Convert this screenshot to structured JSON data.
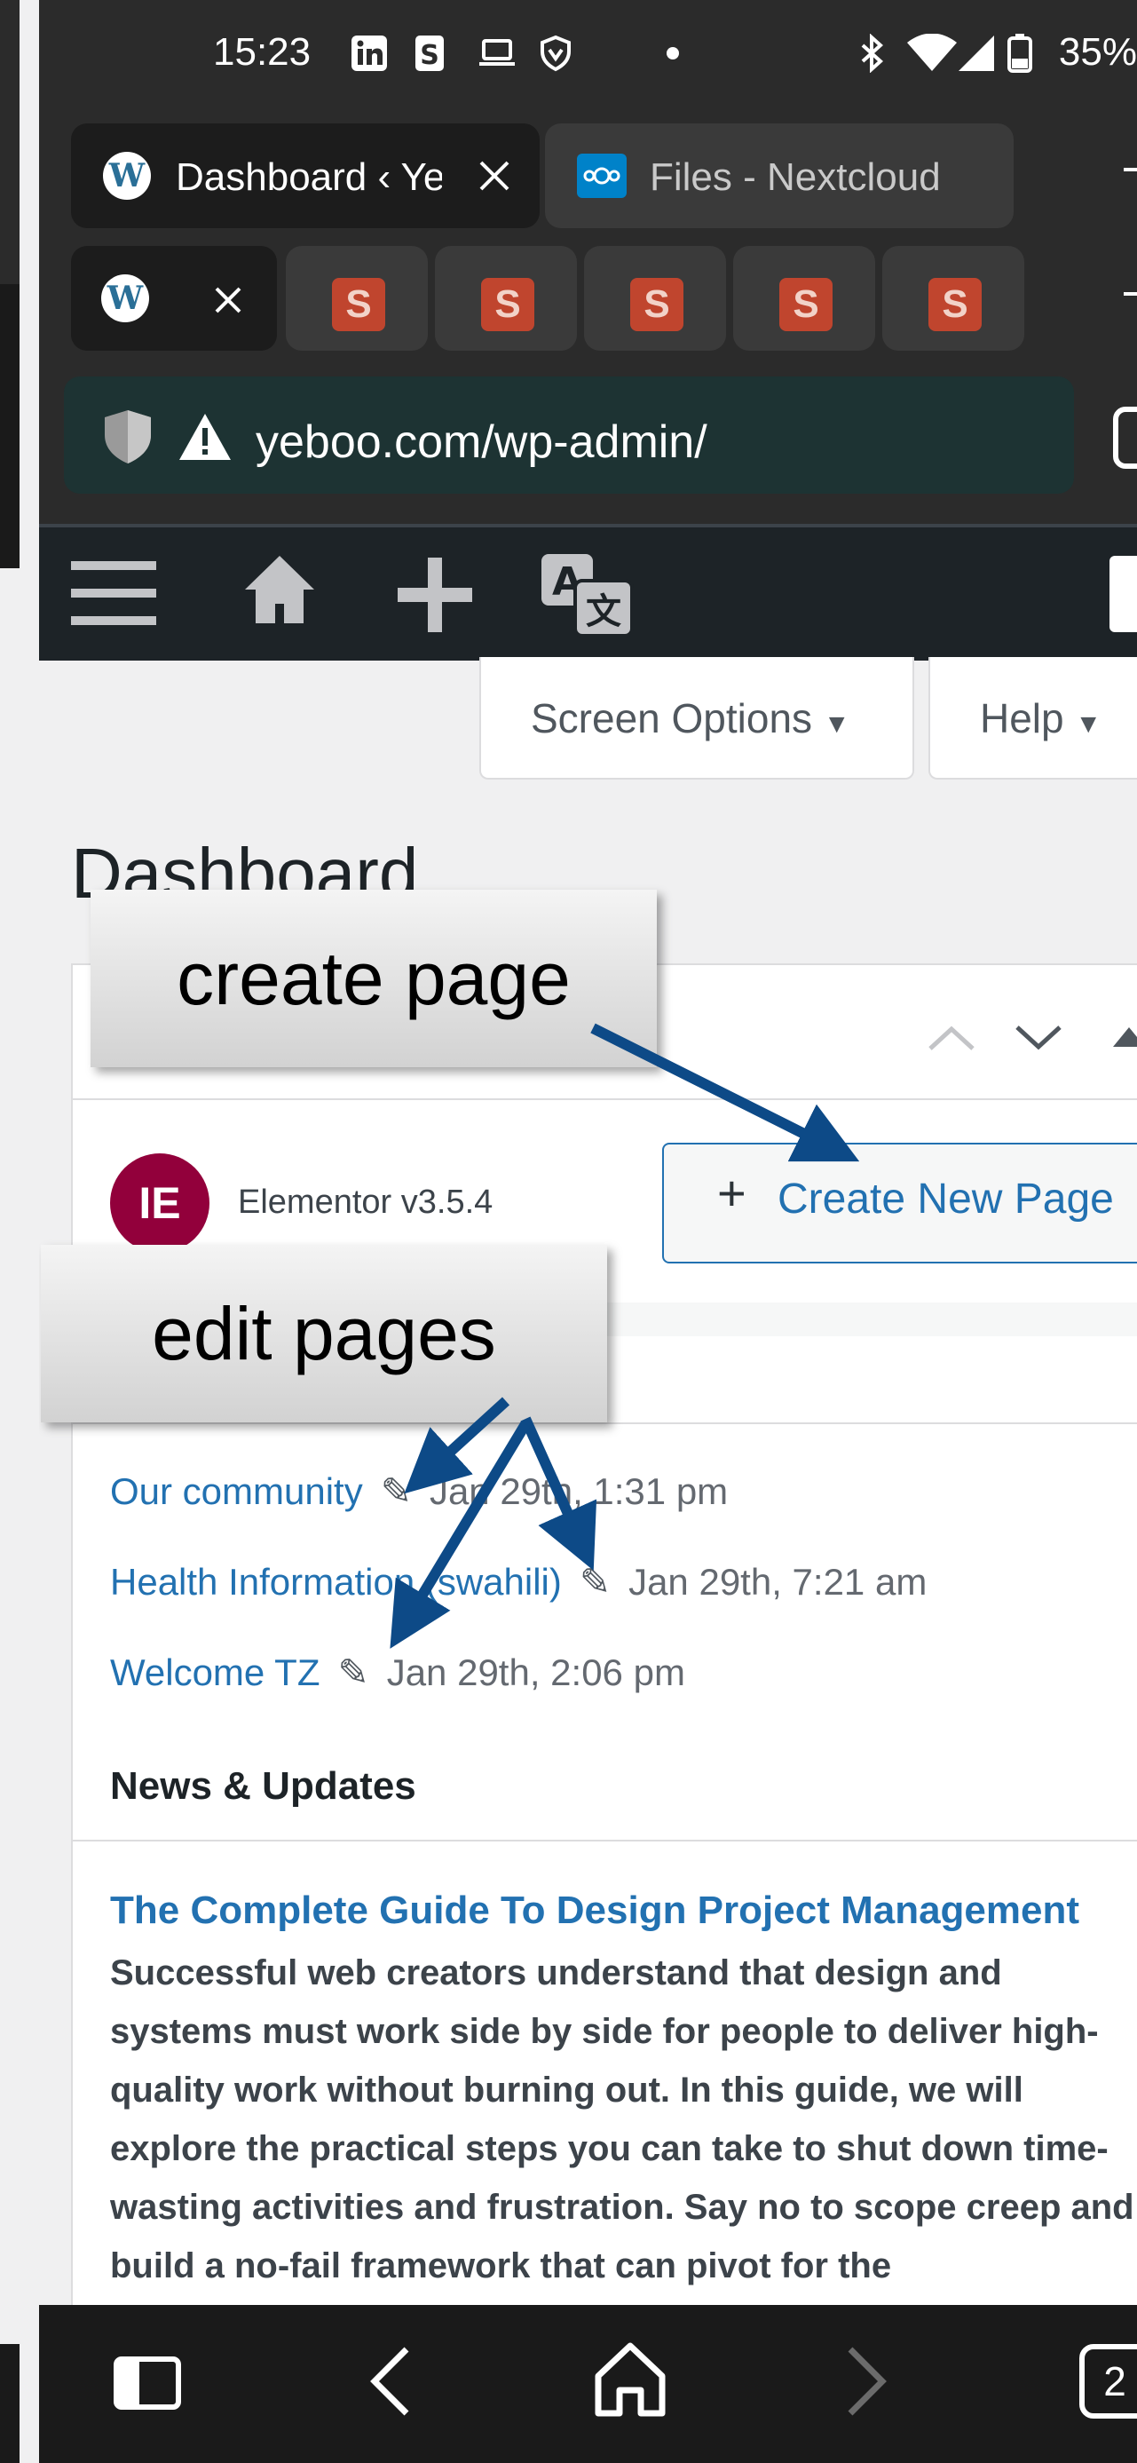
{
  "status_bar": {
    "time": "15:23",
    "notification_icons": [
      "linkedin-icon",
      "s-app-icon",
      "laptop-icon",
      "vpn-icon",
      "dot-icon"
    ],
    "system_icons": [
      "bluetooth-icon",
      "wifi-icon",
      "signal-icon",
      "battery-icon"
    ],
    "battery": "35%"
  },
  "browser": {
    "tab_groups": [
      {
        "title": "Dashboard ‹ Yeboo",
        "icon": "wordpress-icon",
        "active": true
      },
      {
        "title": "Files - Nextcloud",
        "icon": "nextcloud-icon",
        "active": false
      }
    ],
    "tabs_row": [
      {
        "icon": "wordpress-icon",
        "active": true
      },
      {
        "icon": "s-app-icon"
      },
      {
        "icon": "s-app-icon"
      },
      {
        "icon": "s-app-icon"
      },
      {
        "icon": "s-app-icon"
      },
      {
        "icon": "s-app-icon"
      }
    ],
    "url": "yeboo.com/wp-admin/"
  },
  "admin_bar": {
    "icons": [
      "menu-icon",
      "home-icon",
      "plus-icon",
      "translate-icon"
    ]
  },
  "screen_options_label": "Screen Options",
  "help_label": "Help",
  "page_title": "Dashboard",
  "elementor": {
    "logo_letter": "IE",
    "version": "Elementor v3.5.4",
    "create_button": "Create New Page"
  },
  "recent_pages": [
    {
      "title": "Our community",
      "date": "Jan 29th, 1:31 pm"
    },
    {
      "title": "Health Information (swahili)",
      "date": "Jan 29th, 7:21 am"
    },
    {
      "title": "Welcome TZ",
      "date": "Jan 29th, 2:06 pm"
    }
  ],
  "news": {
    "heading": "News & Updates",
    "article_title": "The Complete Guide To Design Project Management",
    "article_excerpt": "Successful web creators understand that design and systems must work side by side for people to deliver high-quality work without burning out. In this guide, we will explore the practical steps you can take to shut down time-wasting activities and frustration. Say no to scope creep and build a no-fail framework that can pivot for the"
  },
  "annotations": {
    "create_callout": "create page",
    "edit_callout": "edit pages"
  },
  "bottom_nav": {
    "tab_count": "2",
    "icons": [
      "tabs-icon",
      "back-icon",
      "home-icon",
      "forward-icon",
      "tab-count-icon"
    ]
  }
}
